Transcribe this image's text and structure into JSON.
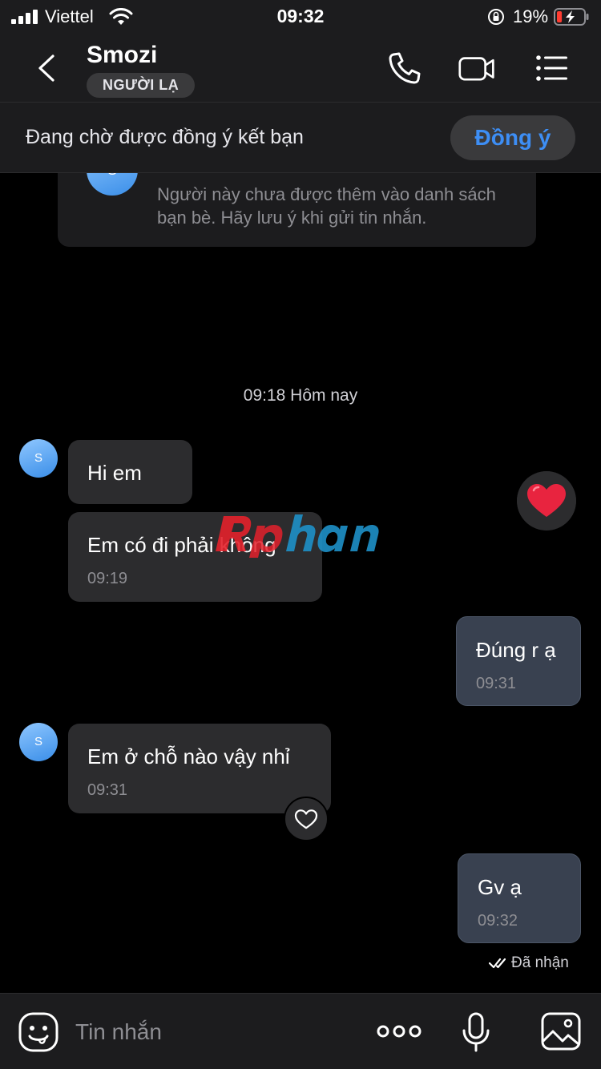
{
  "status_bar": {
    "carrier": "Viettel",
    "time": "09:32",
    "battery_percent": "19%",
    "battery_level": 0.19,
    "battery_color": "#ff3b30"
  },
  "header": {
    "contact_name": "Smozi",
    "badge": "NGƯỜI LẠ"
  },
  "pending": {
    "text": "Đang chờ được đồng ý kết bạn",
    "accept_label": "Đồng ý",
    "accent_color": "#3d8ef5"
  },
  "notice": {
    "avatar_initial": "S",
    "text": "Người này chưa được thêm vào danh sách bạn bè. Hãy lưu ý khi gửi tin nhắn."
  },
  "chat": {
    "date_separator": "09:18 Hôm nay",
    "avatar_initial": "S",
    "messages": [
      {
        "direction": "in",
        "text": "Hi em",
        "time": ""
      },
      {
        "direction": "in",
        "text": "Em có đi phải không",
        "time": "09:19"
      },
      {
        "direction": "out",
        "text": "Đúng r ạ",
        "time": "09:31"
      },
      {
        "direction": "in",
        "text": "Em ở chỗ nào vậy nhỉ",
        "time": "09:31"
      },
      {
        "direction": "out",
        "text": "Gv ạ",
        "time": "09:32"
      }
    ],
    "received_status": "Đã nhận"
  },
  "input_bar": {
    "placeholder": "Tin nhắn"
  }
}
